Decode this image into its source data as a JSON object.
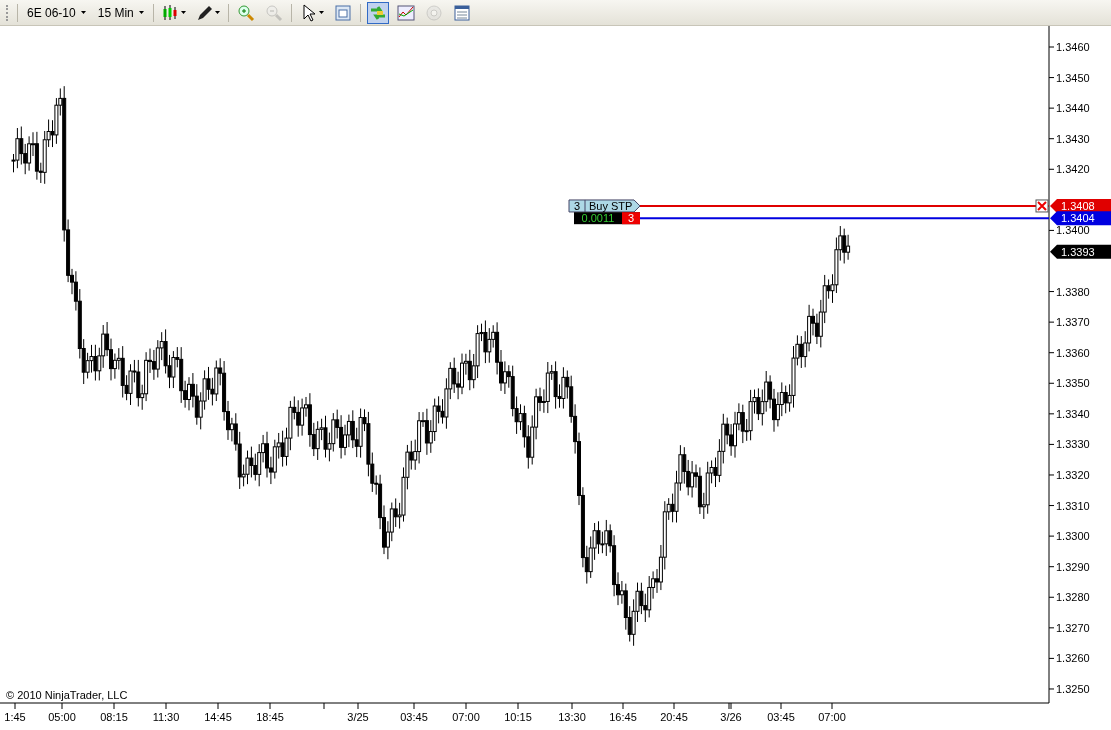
{
  "toolbar": {
    "instrument": "6E 06-10",
    "interval": "15 Min",
    "tools": [
      {
        "kind": "candles",
        "menu": true,
        "selected": false,
        "disabled": false
      },
      {
        "kind": "pencil",
        "menu": true,
        "selected": false,
        "disabled": false
      },
      {
        "kind": "zoom-in",
        "menu": false,
        "selected": false,
        "disabled": false
      },
      {
        "kind": "zoom-out",
        "menu": false,
        "selected": false,
        "disabled": true
      },
      {
        "kind": "cursor",
        "menu": true,
        "selected": false,
        "disabled": false
      },
      {
        "kind": "properties",
        "menu": false,
        "selected": false,
        "disabled": false
      },
      {
        "kind": "orders",
        "menu": false,
        "selected": true,
        "disabled": false
      },
      {
        "kind": "indicators",
        "menu": false,
        "selected": false,
        "disabled": false
      },
      {
        "kind": "strategy",
        "menu": false,
        "selected": false,
        "disabled": true
      },
      {
        "kind": "data-box",
        "menu": false,
        "selected": false,
        "disabled": false
      }
    ]
  },
  "chart": {
    "price_axis": [
      "1.3460",
      "1.3450",
      "1.3440",
      "1.3430",
      "1.3420",
      "1.3400",
      "1.3380",
      "1.3370",
      "1.3360",
      "1.3350",
      "1.3340",
      "1.3330",
      "1.3320",
      "1.3310",
      "1.3300",
      "1.3290",
      "1.3280",
      "1.3270",
      "1.3260",
      "1.3250"
    ],
    "time_axis": [
      "1:45",
      "05:00",
      "08:15",
      "11:30",
      "14:45",
      "18:45",
      "3/25",
      "03:45",
      "07:00",
      "10:15",
      "13:30",
      "16:45",
      "20:45",
      "3/26",
      "03:45",
      "07:00"
    ],
    "stop_order": {
      "quantity": "3",
      "label": "Buy STP",
      "price": "1.3408",
      "color": "#e00000"
    },
    "position": {
      "pnl": "0.0011",
      "quantity": "3",
      "price": "1.3404",
      "color": "#0000e0"
    },
    "last_price": "1.3393",
    "copyright": "© 2010 NinjaTrader, LLC"
  }
}
